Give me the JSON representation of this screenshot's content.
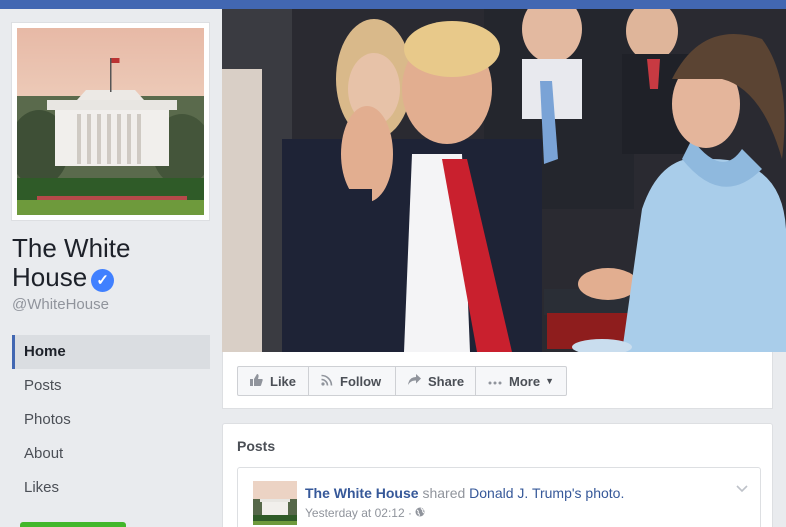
{
  "page": {
    "name": "The White House",
    "verified_mark": "✓",
    "handle": "@WhiteHouse"
  },
  "nav": {
    "items": [
      {
        "label": "Home",
        "active": true
      },
      {
        "label": "Posts"
      },
      {
        "label": "Photos"
      },
      {
        "label": "About"
      },
      {
        "label": "Likes"
      }
    ]
  },
  "actions": {
    "like": {
      "label": "Like",
      "icon": "thumbs-up-icon"
    },
    "follow": {
      "label": "Follow",
      "icon": "rss-icon"
    },
    "share": {
      "label": "Share",
      "icon": "share-arrow-icon"
    },
    "more": {
      "label": "More",
      "icon": "ellipsis-icon",
      "caret": "▼"
    }
  },
  "posts": {
    "title": "Posts",
    "items": [
      {
        "author": "The White House",
        "verb": "shared",
        "target": "Donald J. Trump's photo.",
        "time": "Yesterday at 02:12 ·",
        "privacy_icon": "globe-icon"
      }
    ]
  },
  "colors": {
    "brand": "#4267b2",
    "link": "#365899",
    "verified": "#4080ff",
    "cta_green": "#42b72a",
    "background": "#e9ebee"
  }
}
